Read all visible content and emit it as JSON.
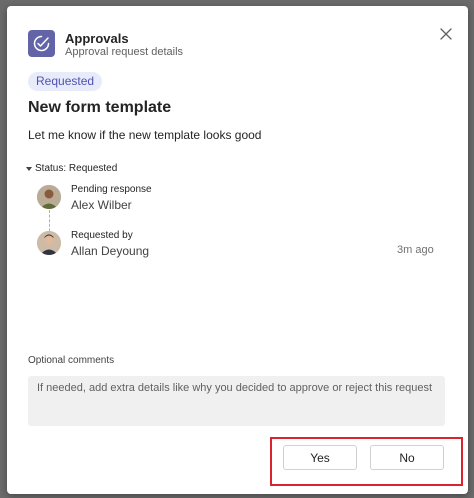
{
  "header": {
    "app_name": "Approvals",
    "app_subtitle": "Approval request details",
    "app_icon": "approvals-check-icon",
    "close_icon": "close-icon"
  },
  "request": {
    "status_badge": "Requested",
    "title": "New form template",
    "description": "Let me know if the new template looks good",
    "status_label": "Status: Requested"
  },
  "people": [
    {
      "role": "Pending response",
      "name": "Alex Wilber",
      "avatar": "avatar"
    },
    {
      "role": "Requested by",
      "name": "Allan Deyoung",
      "avatar": "avatar",
      "time": "3m ago"
    }
  ],
  "comments": {
    "label": "Optional comments",
    "placeholder": "If needed, add extra details like why you decided to approve or reject this request"
  },
  "actions": {
    "yes_label": "Yes",
    "no_label": "No"
  },
  "colors": {
    "brand": "#6264a7",
    "badge_bg": "#e8ebfa",
    "badge_text": "#4f52b2",
    "highlight": "#d9232e"
  }
}
